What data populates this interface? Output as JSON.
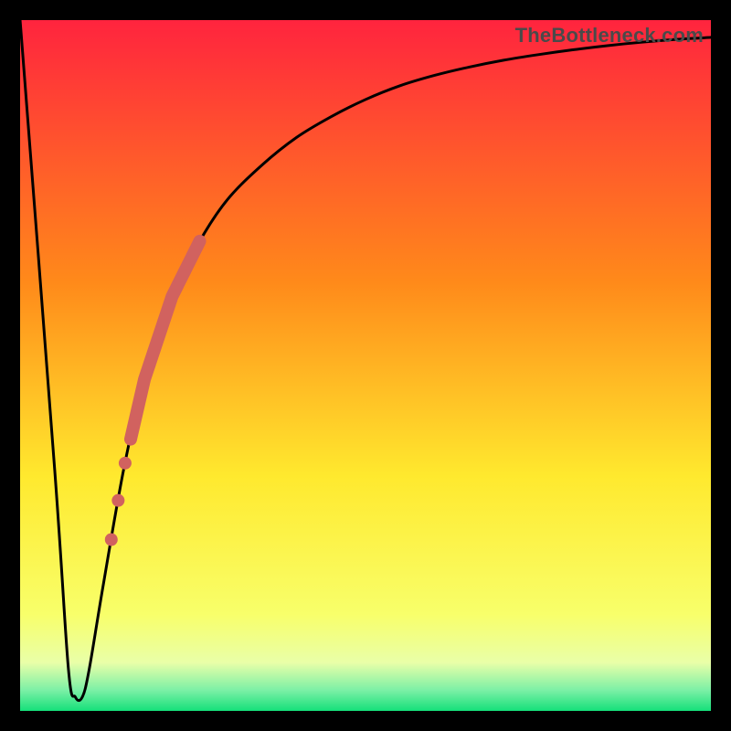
{
  "watermark": "TheBottleneck.com",
  "colors": {
    "frame": "#000000",
    "curve": "#000000",
    "dots": "#d1625f",
    "gradient_top": "#ff243e",
    "gradient_mid1": "#ff8a1a",
    "gradient_mid2": "#ffe92e",
    "gradient_mid3": "#f8ff6a",
    "gradient_bottom": "#15e07a"
  },
  "chart_data": {
    "type": "line",
    "title": "",
    "xlabel": "",
    "ylabel": "",
    "xlim": [
      0,
      100
    ],
    "ylim": [
      0,
      100
    ],
    "series": [
      {
        "name": "bottleneck-curve",
        "x": [
          0,
          5,
          7,
          8,
          9,
          10,
          12,
          15,
          18,
          22,
          26,
          30,
          35,
          40,
          45,
          50,
          55,
          60,
          65,
          70,
          75,
          80,
          85,
          90,
          95,
          100
        ],
        "y": [
          100,
          35,
          6,
          2,
          2,
          6,
          18,
          35,
          48,
          60,
          68,
          74,
          79,
          83,
          86,
          88.5,
          90.5,
          92,
          93.2,
          94.2,
          95,
          95.7,
          96.3,
          96.8,
          97.2,
          97.5
        ]
      }
    ],
    "highlight_band": {
      "name": "highlighted-range-on-curve",
      "x_start": 16,
      "x_end": 26
    },
    "highlight_dots": {
      "name": "isolated-points-on-curve",
      "x": [
        15.2,
        14.2,
        13.2
      ]
    }
  }
}
